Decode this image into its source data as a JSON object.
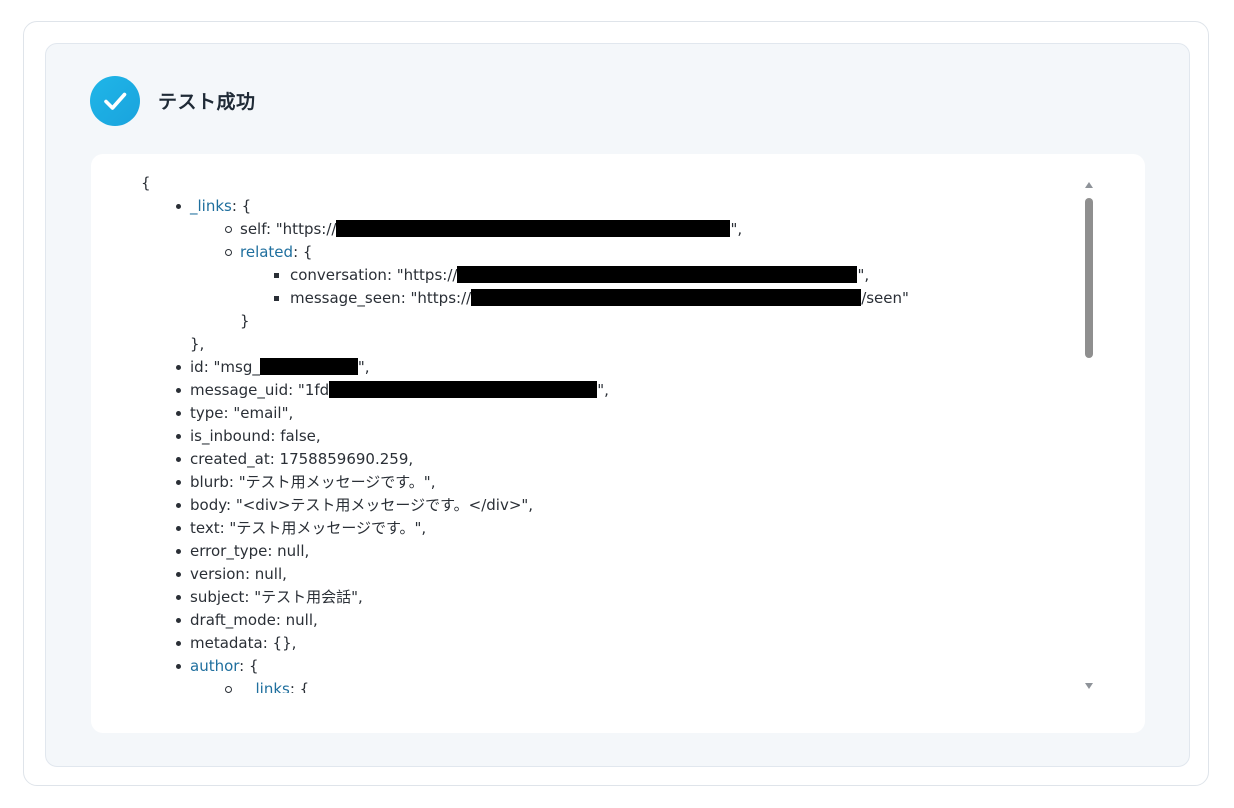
{
  "status": {
    "title": "テスト成功",
    "icon": "checkmark-icon",
    "accent": "#1aa3dd"
  },
  "json": {
    "open_brace": "{",
    "links_key": "_links",
    "links_open": ": {",
    "self_prefix": "self: \"https://",
    "self_suffix": "\",",
    "related_key": "related",
    "related_open": ": {",
    "conversation_prefix": "conversation: \"https://",
    "conversation_suffix": "\",",
    "message_seen_prefix": "message_seen: \"https://",
    "message_seen_suffix": "/seen\"",
    "related_close": "}",
    "links_close": "},",
    "id_prefix": "id: \"msg_",
    "id_suffix": "\",",
    "message_uid_prefix": "message_uid: \"1fd",
    "message_uid_suffix": "\",",
    "type_line": "type: \"email\",",
    "is_inbound_line": "is_inbound: false,",
    "created_at_line": "created_at: 1758859690.259,",
    "blurb_line": "blurb: \"テスト用メッセージです。\",",
    "body_line": "body: \"<div>テスト用メッセージです。</div>\",",
    "text_line": "text: \"テスト用メッセージです。\",",
    "error_type_line": "error_type: null,",
    "version_line": "version: null,",
    "subject_line": "subject: \"テスト用会話\",",
    "draft_mode_line": "draft_mode: null,",
    "metadata_line": "metadata: {},",
    "author_key": "author",
    "author_open": ": {",
    "author_links_key": "_links",
    "author_links_open": ": {"
  }
}
